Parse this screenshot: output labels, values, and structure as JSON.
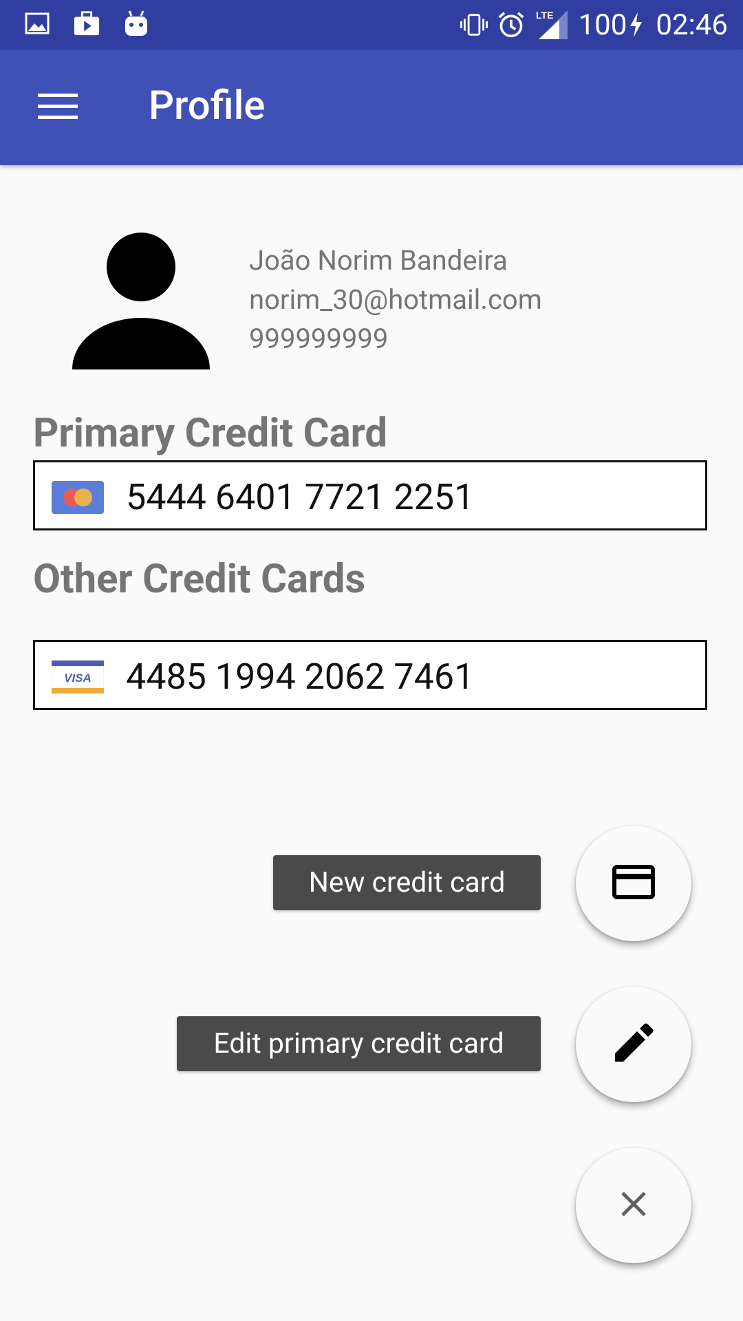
{
  "status_bar": {
    "battery": "100",
    "time": "02:46",
    "network": "LTE",
    "icons": [
      "image-icon",
      "briefcase-play-icon",
      "android-icon",
      "vibrate-icon",
      "alarm-icon",
      "signal-icon",
      "charging-icon"
    ]
  },
  "app_bar": {
    "title": "Profile",
    "menu_icon": "menu-icon",
    "color": "#3f51b5",
    "status_color": "#303f9f"
  },
  "profile": {
    "name": "João Norim Bandeira",
    "email": "norim_30@hotmail.com",
    "phone": "999999999",
    "avatar_icon": "person-icon"
  },
  "primary_card": {
    "heading": "Primary Credit Card",
    "brand_icon": "mastercard-icon",
    "number": "5444 6401 7721 2251"
  },
  "other_cards": {
    "heading": "Other Credit Cards",
    "items": [
      {
        "brand_icon": "visa-icon",
        "brand_text": "VISA",
        "number": "4485 1994 2062 7461"
      }
    ]
  },
  "fab_menu": {
    "new_card_label": "New credit card",
    "new_card_icon": "credit-card-icon",
    "edit_primary_label": "Edit primary credit card",
    "edit_primary_icon": "pencil-icon",
    "close_icon": "close-icon"
  }
}
